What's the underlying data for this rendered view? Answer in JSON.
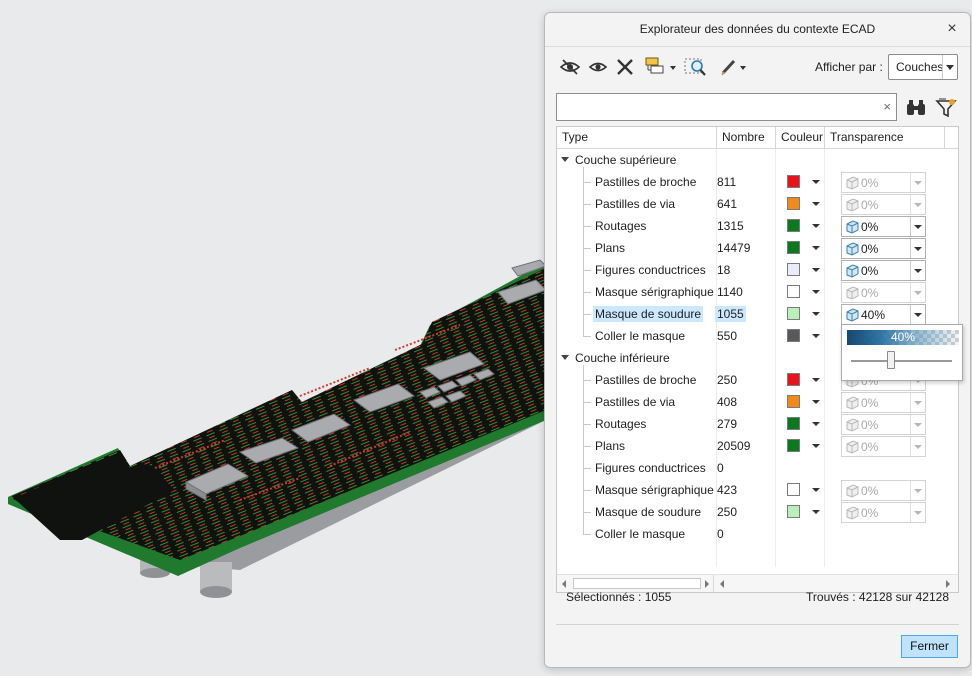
{
  "dialog": {
    "title": "Explorateur des données du contexte ECAD",
    "close_icon": "×",
    "display_by_label": "Afficher par :",
    "display_by_value": "Couches",
    "search_placeholder": "",
    "search_clear": "×"
  },
  "toolbar": {
    "icons": [
      "hide-icon",
      "show-icon",
      "delete-icon",
      "group-icon",
      "zoom-to-icon",
      "edit-pen-icon"
    ]
  },
  "grid": {
    "columns": [
      "Type",
      "Nombre",
      "Couleur",
      "Transparence"
    ],
    "groups": [
      {
        "label": "Couche supérieure",
        "rows": [
          {
            "type": "Pastilles de broche",
            "count": "811",
            "color": "#e8141c",
            "transparency": "0%",
            "enabled": false
          },
          {
            "type": "Pastilles de via",
            "count": "641",
            "color": "#f28a1b",
            "transparency": "0%",
            "enabled": false
          },
          {
            "type": "Routages",
            "count": "1315",
            "color": "#0a7a1e",
            "transparency": "0%",
            "enabled": true
          },
          {
            "type": "Plans",
            "count": "14479",
            "color": "#0a7a1e",
            "transparency": "0%",
            "enabled": true
          },
          {
            "type": "Figures conductrices",
            "count": "18",
            "color": "#ececf9",
            "transparency": "0%",
            "enabled": true
          },
          {
            "type": "Masque sérigraphique",
            "count": "1140",
            "color": "#ffffff",
            "transparency": "0%",
            "enabled": false
          },
          {
            "type": "Masque de soudure",
            "count": "1055",
            "color": "#b9f0b9",
            "transparency": "40%",
            "enabled": true,
            "selected": true
          },
          {
            "type": "Coller le masque",
            "count": "550",
            "color": "#59595c",
            "transparency": "",
            "enabled": false
          }
        ]
      },
      {
        "label": "Couche inférieure",
        "rows": [
          {
            "type": "Pastilles de broche",
            "count": "250",
            "color": "#e8141c",
            "transparency": "0%",
            "enabled": false
          },
          {
            "type": "Pastilles de via",
            "count": "408",
            "color": "#f28a1b",
            "transparency": "0%",
            "enabled": false
          },
          {
            "type": "Routages",
            "count": "279",
            "color": "#0a7a1e",
            "transparency": "0%",
            "enabled": false
          },
          {
            "type": "Plans",
            "count": "20509",
            "color": "#0a7a1e",
            "transparency": "0%",
            "enabled": false
          },
          {
            "type": "Figures conductrices",
            "count": "0",
            "color": "",
            "transparency": "",
            "enabled": false
          },
          {
            "type": "Masque sérigraphique",
            "count": "423",
            "color": "#ffffff",
            "transparency": "0%",
            "enabled": false
          },
          {
            "type": "Masque de soudure",
            "count": "250",
            "color": "#b9f0b9",
            "transparency": "0%",
            "enabled": false
          },
          {
            "type": "Coller le masque",
            "count": "0",
            "color": "",
            "transparency": "",
            "enabled": false
          }
        ]
      }
    ]
  },
  "popup": {
    "value": "40%",
    "level": 0.4
  },
  "status": {
    "selected": "Sélectionnés : 1055",
    "found": "Trouvés : 42128 sur 42128"
  },
  "footer": {
    "close_label": "Fermer"
  },
  "colors": {
    "accent": "#4ea4dd",
    "selection": "#cce8ff"
  }
}
